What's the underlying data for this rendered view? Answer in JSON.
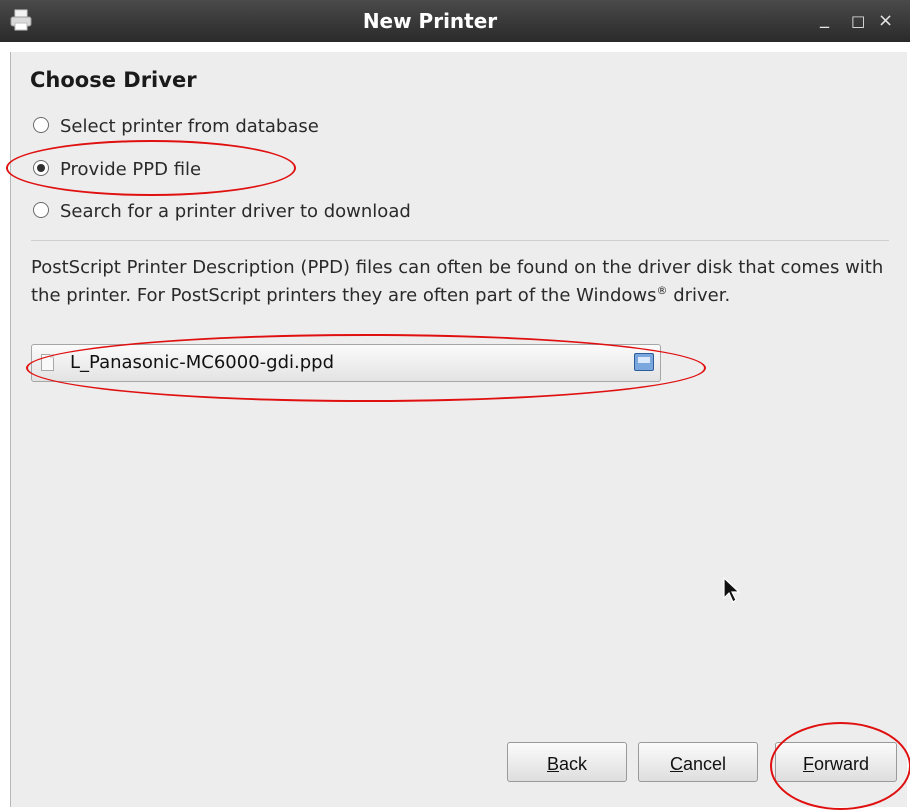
{
  "window": {
    "title": "New Printer",
    "controls": {
      "minimize": "_",
      "maximize": "□",
      "close": "×"
    }
  },
  "page": {
    "heading": "Choose Driver",
    "options": [
      {
        "label": "Select printer from database",
        "selected": false
      },
      {
        "label": "Provide PPD file",
        "selected": true
      },
      {
        "label": "Search for a printer driver to download",
        "selected": false
      }
    ],
    "description": {
      "text": "PostScript Printer Description (PPD) files can often be found on the driver disk that comes with the printer. For PostScript printers they are often part of the Windows",
      "registered": "®",
      "suffix": " driver."
    },
    "file": {
      "name": "L_Panasonic-MC6000-gdi.ppd"
    }
  },
  "buttons": {
    "back": {
      "mnemonic": "B",
      "rest": "ack"
    },
    "cancel": {
      "mnemonic": "C",
      "rest": "ancel"
    },
    "forward": {
      "mnemonic": "F",
      "rest": "orward"
    }
  },
  "icons": {
    "app": "printer-icon",
    "file": "document-icon",
    "browse": "folder-browse-icon",
    "cursor": "mouse-pointer-icon"
  },
  "colors": {
    "titlebar": "#333333",
    "dialog_bg": "#ededed",
    "annotation": "#e01010"
  }
}
